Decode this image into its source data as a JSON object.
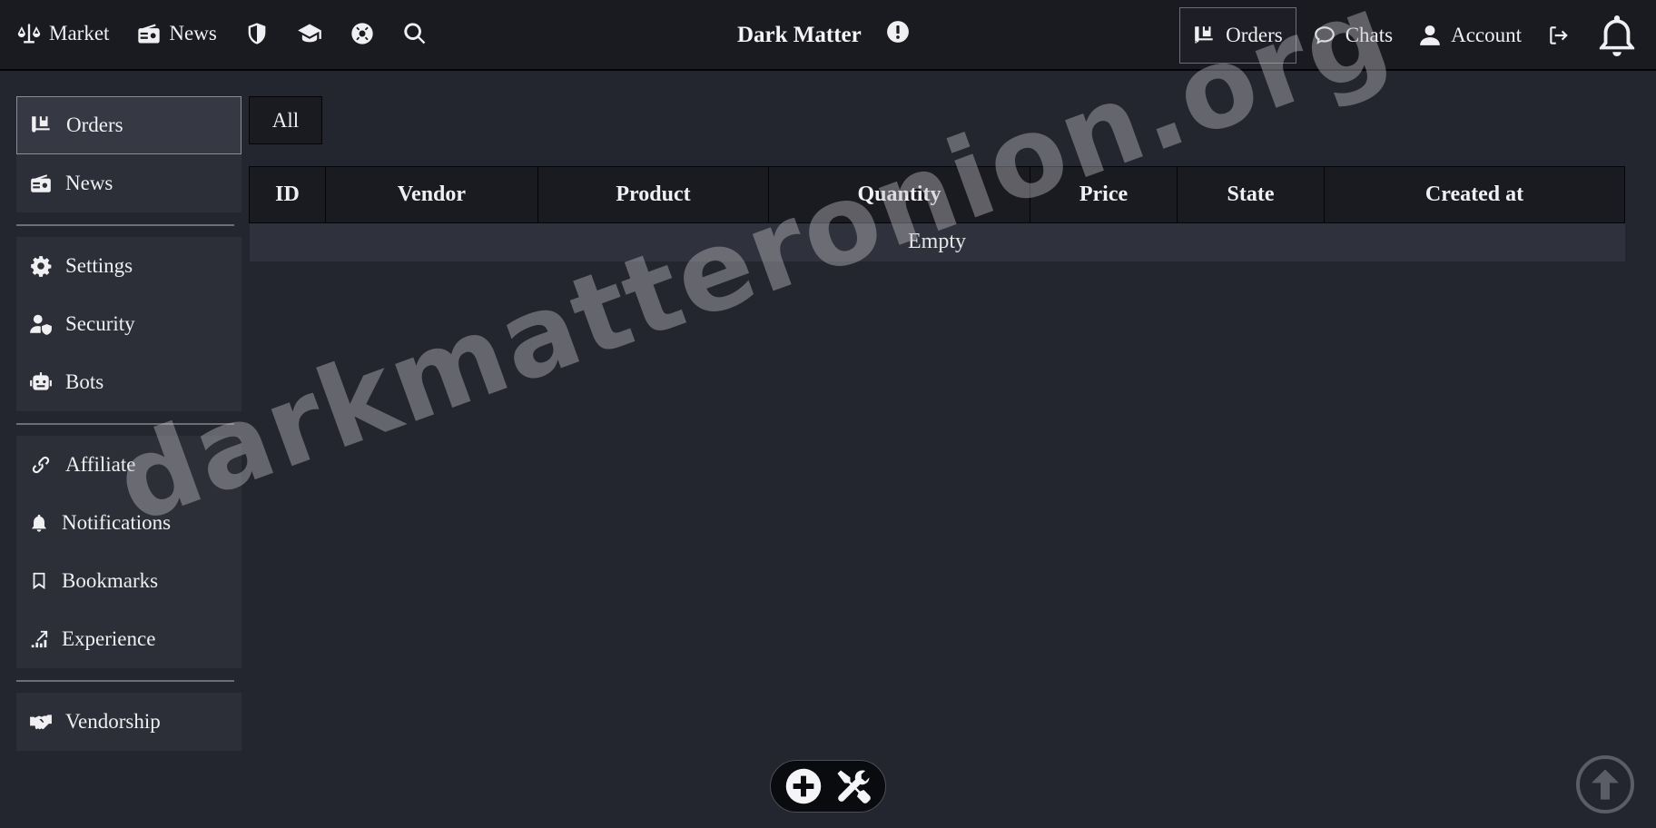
{
  "topnav": {
    "left": [
      {
        "label": "Market",
        "icon": "scale-icon"
      },
      {
        "label": "News",
        "icon": "radio-icon"
      },
      {
        "label": "",
        "icon": "shield-icon"
      },
      {
        "label": "",
        "icon": "graduation-cap-icon"
      },
      {
        "label": "",
        "icon": "life-ring-icon"
      },
      {
        "label": "",
        "icon": "search-icon"
      }
    ],
    "brand": "Dark Matter",
    "right": {
      "orders": "Orders",
      "chats": "Chats",
      "account": "Account"
    }
  },
  "sidebar": {
    "group1": [
      "Orders",
      "News"
    ],
    "group2": [
      "Settings",
      "Security",
      "Bots"
    ],
    "group3": [
      "Affiliate",
      "Notifications",
      "Bookmarks",
      "Experience"
    ],
    "group4": [
      "Vendorship"
    ]
  },
  "main": {
    "filter_tab": "All",
    "table": {
      "headers": [
        "ID",
        "Vendor",
        "Product",
        "Quantity",
        "Price",
        "State",
        "Created at"
      ],
      "empty_text": "Empty"
    }
  },
  "watermark": "darkmatteronion.org",
  "colors": {
    "background": "#23252f",
    "topbar": "#1a1b21",
    "panel": "#2c2e38",
    "text": "#f0f0f2"
  }
}
